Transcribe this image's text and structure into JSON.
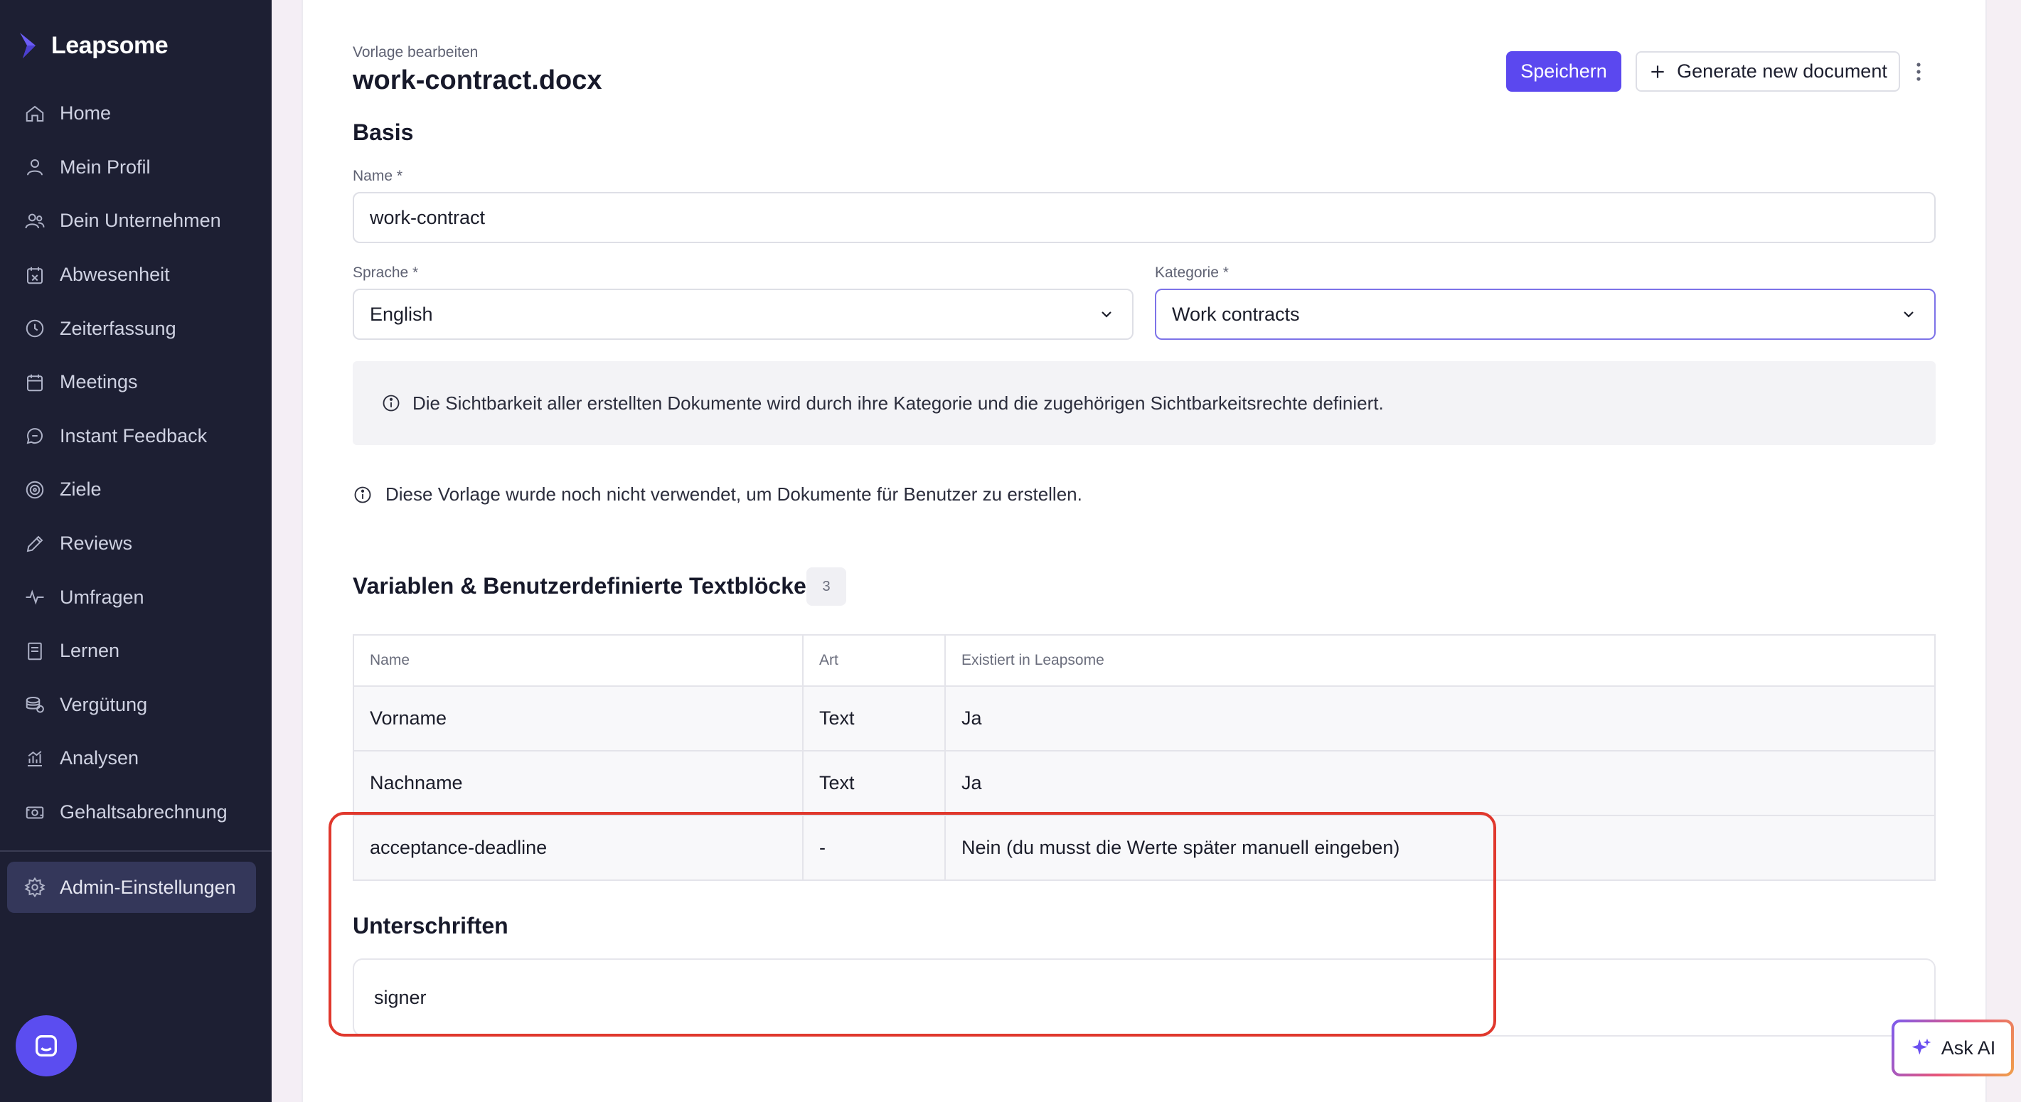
{
  "app": {
    "brand": "Leapsome"
  },
  "sidebar": {
    "items": [
      {
        "label": "Home",
        "icon": "home-icon"
      },
      {
        "label": "Mein Profil",
        "icon": "user-icon"
      },
      {
        "label": "Dein Unternehmen",
        "icon": "users-icon"
      },
      {
        "label": "Abwesenheit",
        "icon": "calendar-x-icon"
      },
      {
        "label": "Zeiterfassung",
        "icon": "clock-icon"
      },
      {
        "label": "Meetings",
        "icon": "calendar-icon"
      },
      {
        "label": "Instant Feedback",
        "icon": "chat-icon"
      },
      {
        "label": "Ziele",
        "icon": "target-icon"
      },
      {
        "label": "Reviews",
        "icon": "pencil-icon"
      },
      {
        "label": "Umfragen",
        "icon": "pulse-icon"
      },
      {
        "label": "Lernen",
        "icon": "book-icon"
      },
      {
        "label": "Vergütung",
        "icon": "coins-icon"
      },
      {
        "label": "Analysen",
        "icon": "chart-icon"
      },
      {
        "label": "Gehaltsabrechnung",
        "icon": "money-icon"
      }
    ],
    "admin": {
      "label": "Admin-Einstellungen",
      "icon": "gear-icon"
    }
  },
  "header": {
    "kicker": "Vorlage bearbeiten",
    "title": "work-contract.docx",
    "save_label": "Speichern",
    "generate_label": "Generate new document"
  },
  "basis": {
    "heading": "Basis",
    "name_label": "Name *",
    "name_value": "work-contract",
    "sprache_label": "Sprache *",
    "sprache_value": "English",
    "kategorie_label": "Kategorie *",
    "kategorie_value": "Work contracts",
    "visibility_info": "Die Sichtbarkeit aller erstellten Dokumente wird durch ihre Kategorie und die zugehörigen Sichtbarkeitsrechte definiert.",
    "usage_info": "Diese Vorlage wurde noch nicht verwendet, um Dokumente für Benutzer zu erstellen."
  },
  "variables": {
    "heading": "Variablen & Benutzerdefinierte Textblöcke",
    "count": "3",
    "columns": [
      "Name",
      "Art",
      "Existiert in Leapsome"
    ],
    "rows": [
      [
        "Vorname",
        "Text",
        "Ja"
      ],
      [
        "Nachname",
        "Text",
        "Ja"
      ],
      [
        "acceptance-deadline",
        "-",
        "Nein (du musst die Werte später manuell eingeben)"
      ]
    ]
  },
  "signatures": {
    "heading": "Unterschriften",
    "signer": "signer"
  },
  "ask_ai": {
    "label": "Ask AI"
  },
  "colors": {
    "sidebar_bg": "#1d1f33",
    "accent": "#5b48ef",
    "highlight": "#e0382d"
  }
}
